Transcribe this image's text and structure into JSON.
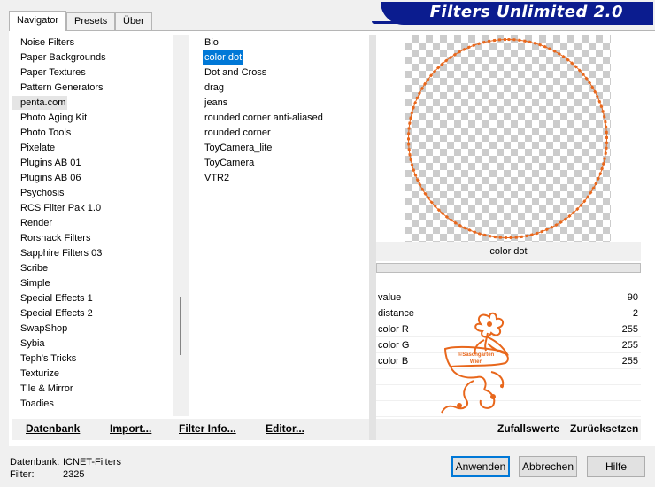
{
  "tabs": [
    {
      "label": "Navigator",
      "active": true
    },
    {
      "label": "Presets",
      "active": false
    },
    {
      "label": "Über",
      "active": false
    }
  ],
  "banner": {
    "title": "Filters Unlimited 2.0",
    "color": "#0b1c8f"
  },
  "categories": [
    "Noise Filters",
    "Paper Backgrounds",
    "Paper Textures",
    "Pattern Generators",
    "penta.com",
    "Photo Aging Kit",
    "Photo Tools",
    "Pixelate",
    "Plugins AB 01",
    "Plugins AB 06",
    "Psychosis",
    "RCS Filter Pak 1.0",
    "Render",
    "Rorshack Filters",
    "Sapphire Filters 03",
    "Scribe",
    "Simple",
    "Special Effects 1",
    "Special Effects 2",
    "SwapShop",
    "Sybia",
    "Teph's Tricks",
    "Texturize",
    "Tile & Mirror",
    "Toadies"
  ],
  "selected_category": "penta.com",
  "filters": [
    "Bio",
    "color dot",
    "Dot and Cross",
    "drag",
    "jeans",
    "rounded corner anti-aliased",
    "rounded corner",
    "ToyCamera_lite",
    "ToyCamera",
    "VTR2"
  ],
  "selected_filter": "color dot",
  "preview": {
    "filter_name": "color dot",
    "stroke_color": "#e8671c"
  },
  "params": [
    {
      "name": "value",
      "value": "90"
    },
    {
      "name": "distance",
      "value": "2"
    },
    {
      "name": "color R",
      "value": "255"
    },
    {
      "name": "color G",
      "value": "255"
    },
    {
      "name": "color B",
      "value": "255"
    }
  ],
  "watermark": {
    "line1": "©Saschgarten",
    "line2": "Wien"
  },
  "buttons_left": {
    "database": "Datenbank",
    "import": "Import...",
    "filter_info": "Filter Info...",
    "editor": "Editor..."
  },
  "buttons_right": {
    "random": "Zufallswerte",
    "reset": "Zurücksetzen"
  },
  "footer": {
    "db_label": "Datenbank:",
    "db_value": "ICNET-Filters",
    "filter_label": "Filter:",
    "filter_value": "2325"
  },
  "dialog_buttons": {
    "apply": "Anwenden",
    "cancel": "Abbrechen",
    "help": "Hilfe"
  }
}
